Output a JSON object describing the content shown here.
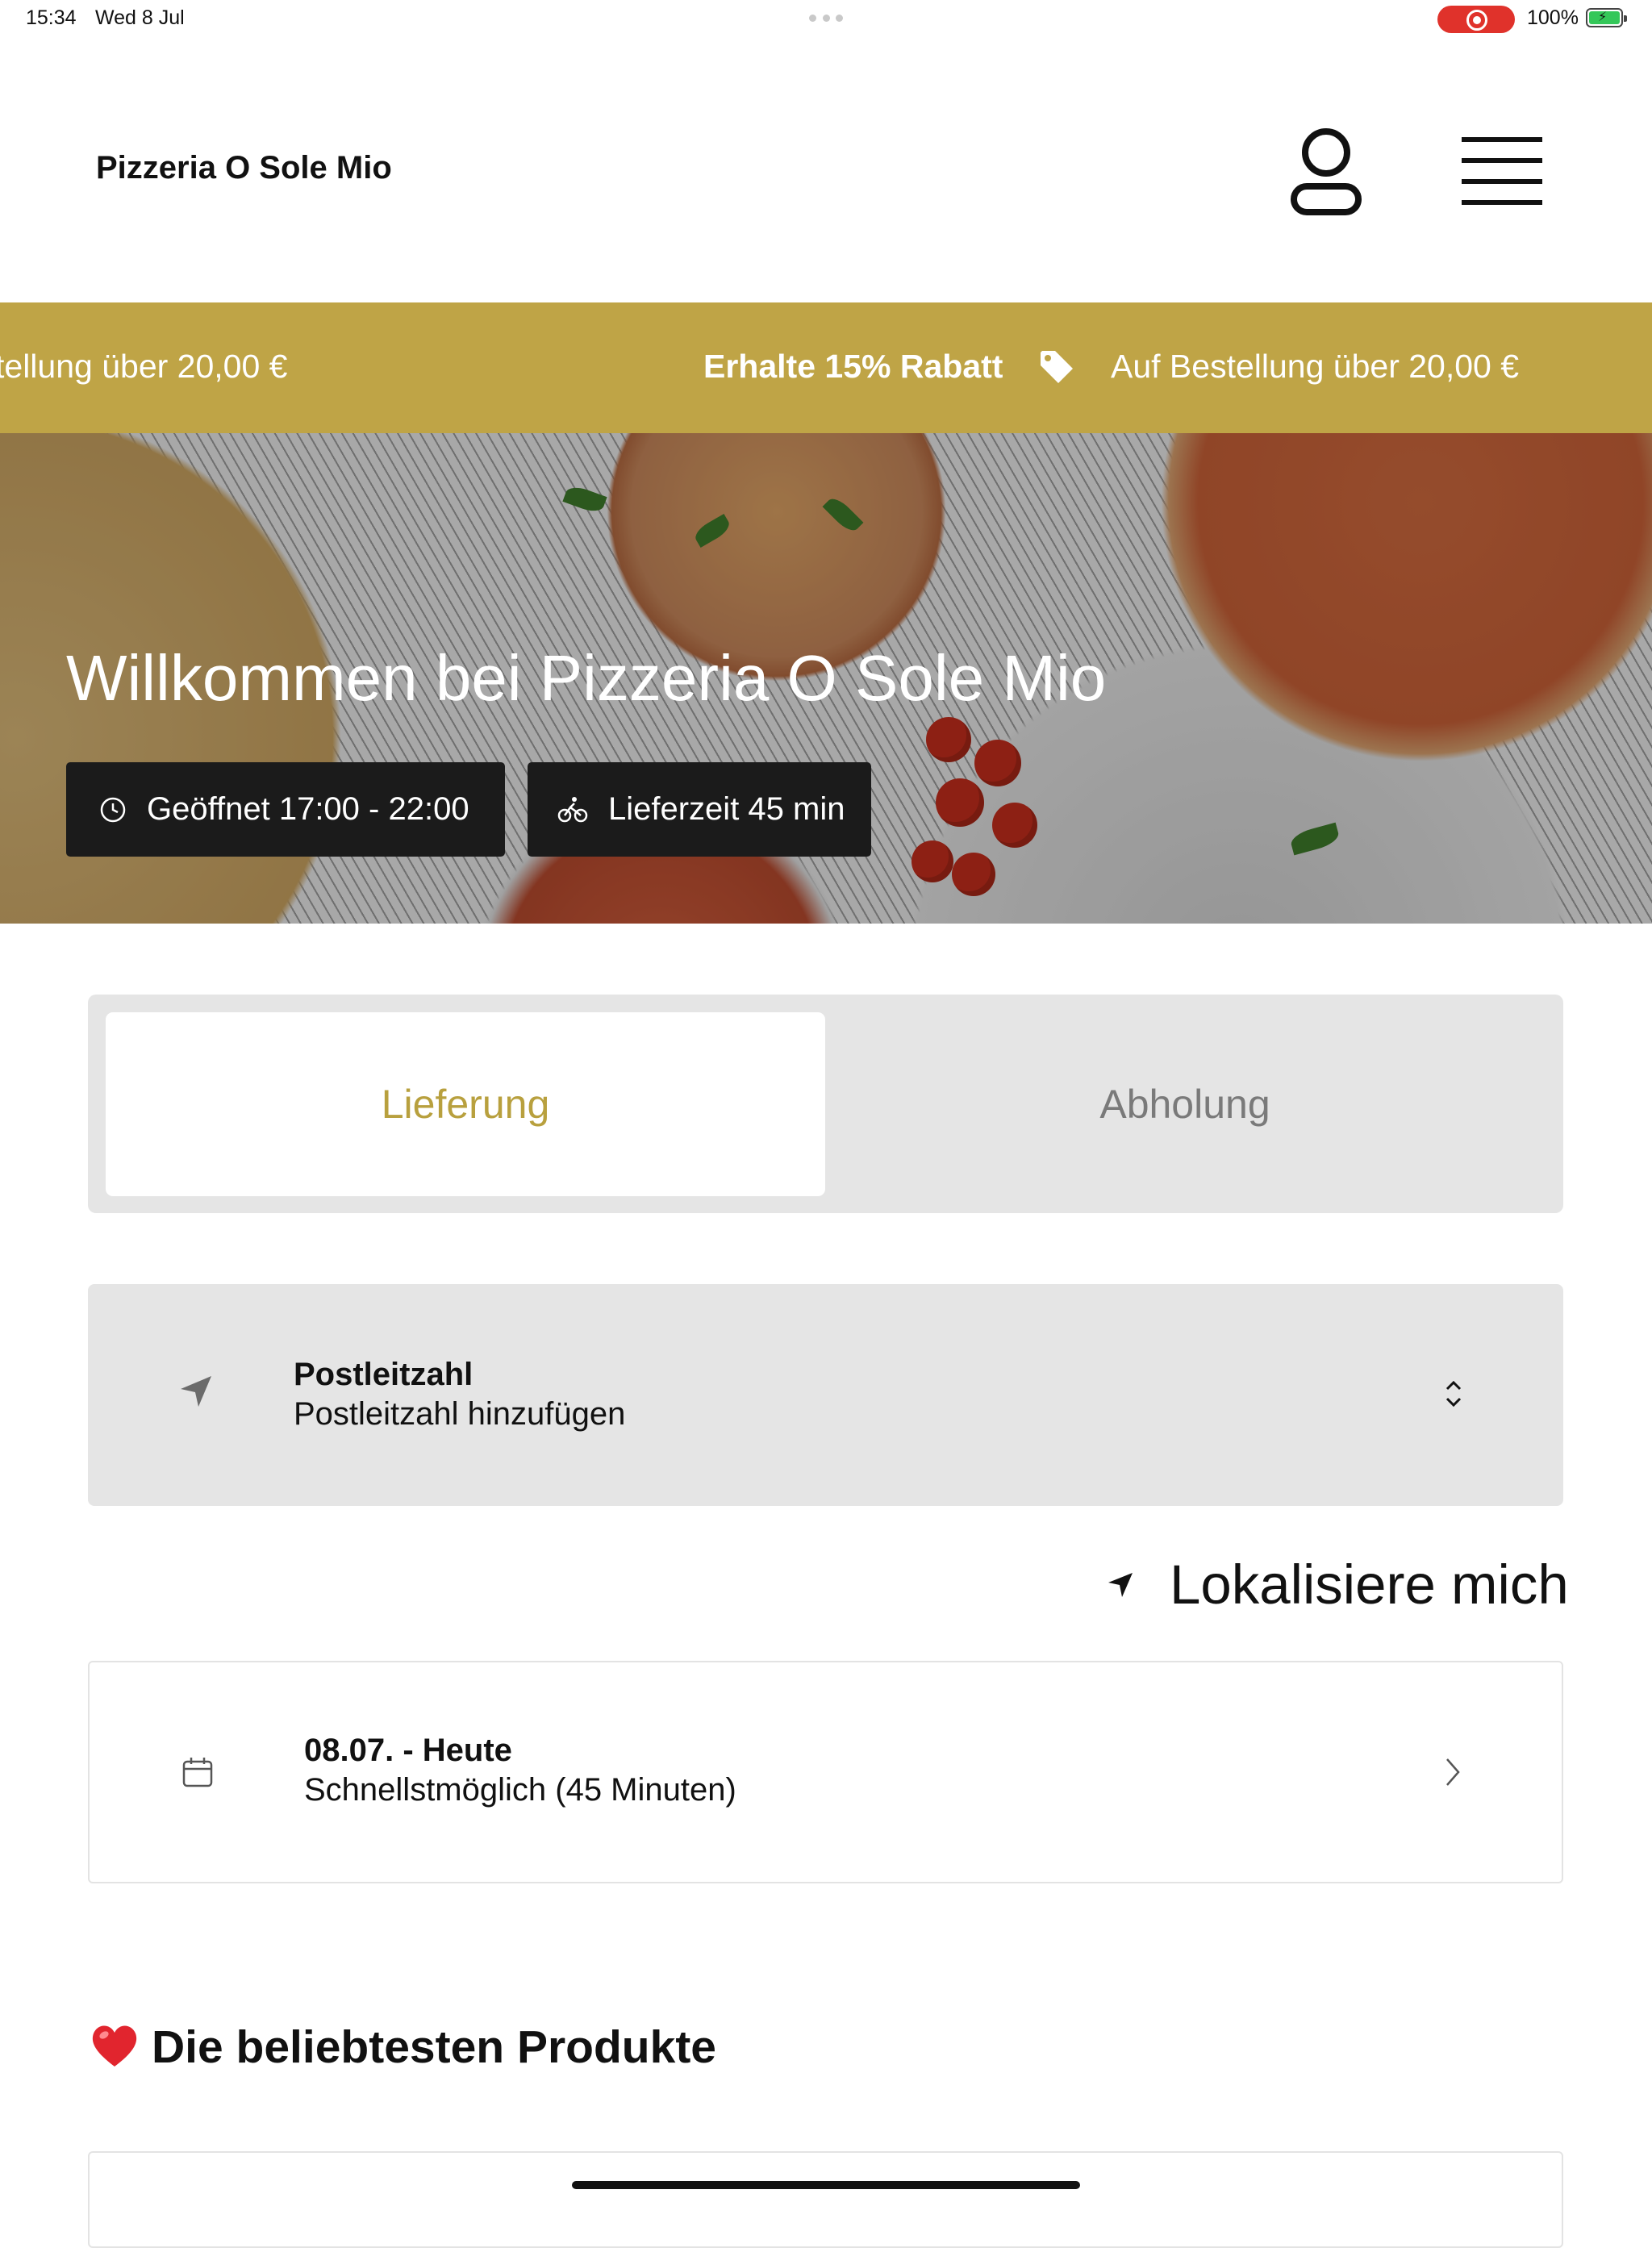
{
  "status_bar": {
    "time": "15:34",
    "date": "Wed 8 Jul",
    "battery": "100%",
    "recording_color": "#e0322b",
    "battery_color": "#34c759"
  },
  "header": {
    "brand": "Pizzeria O Sole Mio",
    "account_icon": "user-icon",
    "menu_icon": "hamburger-menu-icon"
  },
  "promo": {
    "left_fragment": "tellung über 20,00 €",
    "highlight": "Erhalte 15% Rabatt",
    "condition": "Auf Bestellung über 20,00 €",
    "icon": "tag-icon",
    "color": "#bfa446"
  },
  "hero": {
    "title": "Willkommen bei Pizzeria O Sole Mio",
    "opening_hours": "Geöffnet 17:00 - 22:00",
    "delivery_time": "Lieferzeit 45 min"
  },
  "order_mode": {
    "delivery": "Lieferung",
    "pickup": "Abholung",
    "selected": "Lieferung",
    "accent": "#b8a03e"
  },
  "postcode": {
    "label": "Postleitzahl",
    "value": "Postleitzahl hinzufügen"
  },
  "locate": {
    "label": "Lokalisiere mich"
  },
  "schedule": {
    "title": "08.07. - Heute",
    "subtitle": "Schnellstmöglich (45 Minuten)"
  },
  "popular": {
    "title": "Die beliebtesten Produkte",
    "icon": "heart-icon"
  }
}
